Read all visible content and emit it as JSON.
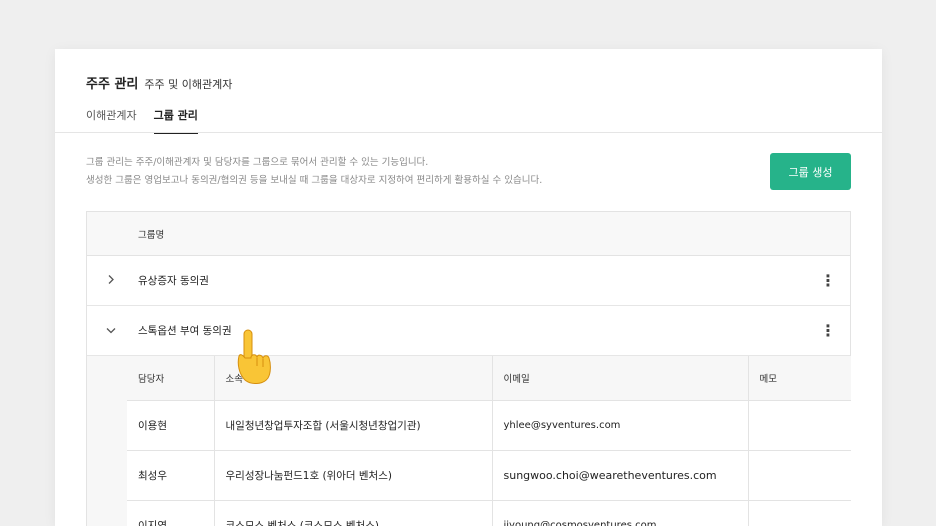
{
  "header": {
    "title": "주주 관리",
    "subtitle": "주주 및 이해관계자"
  },
  "tabs": [
    {
      "label": "이해관계자",
      "active": false
    },
    {
      "label": "그룹 관리",
      "active": true
    }
  ],
  "description": {
    "line1": "그룹 관리는 주주/이해관계자 및 담당자를 그룹으로 묶어서 관리할 수 있는 기능입니다.",
    "line2": "생성한 그룹은 영업보고나 동의권/협의권 등을 보내실 때 그룹을 대상자로 지정하여 편리하게 활용하실 수 있습니다."
  },
  "create_button": {
    "label": "그룹 생성",
    "color": "#26b38a"
  },
  "group_table": {
    "header": "그룹명",
    "groups": [
      {
        "name": "유상증자 동의권",
        "expanded": false,
        "chevron_icon": "chevron-right-icon"
      },
      {
        "name": "스톡옵션 부여 동의권",
        "expanded": true,
        "chevron_icon": "chevron-down-icon"
      }
    ],
    "member_columns": [
      "담당자",
      "소속",
      "이메일",
      "메모"
    ],
    "members": [
      {
        "name": "이용현",
        "affiliation": "내일청년창업투자조합 (서울시청년창업기관)",
        "email": "yhlee@syventures.com",
        "memo": ""
      },
      {
        "name": "최성우",
        "affiliation": "우리성장나눔펀드1호 (위아더 벤처스)",
        "email": "sungwoo.choi@wearetheventures.com",
        "memo": ""
      },
      {
        "name": "이지영",
        "affiliation": "코스모스 벤처스 (코스모스 벤처스)",
        "email": "jiyoung@cosmosventures.com",
        "memo": ""
      }
    ]
  },
  "cursor": {
    "icon": "pointing-hand-icon"
  }
}
